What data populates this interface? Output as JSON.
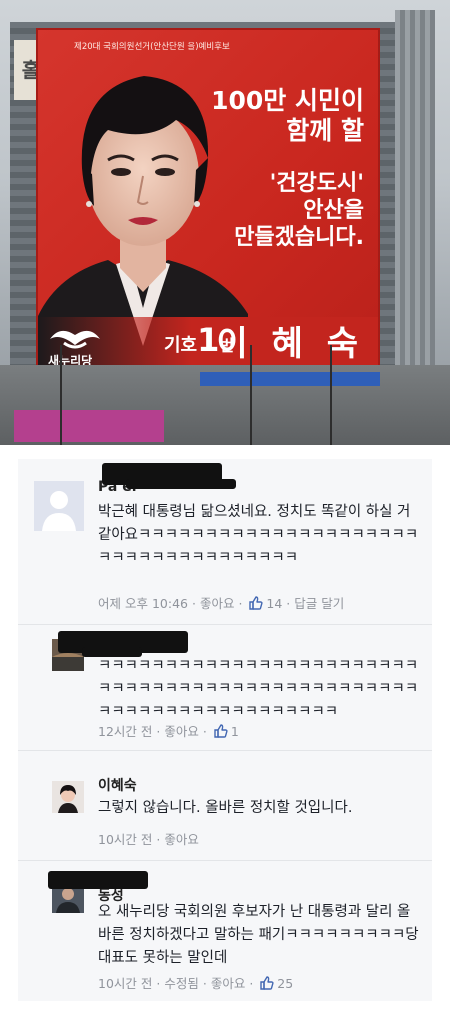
{
  "billboard": {
    "top_caption": "제20대 국회의원선거(안산단원 을)예비후보",
    "left_sign": "홀",
    "slogan": [
      "100만 시민이",
      "함께 할",
      "'건강도시'",
      "안산을",
      "만들겠습니다."
    ],
    "party_name": "새누리당",
    "candidate_label": "기호",
    "candidate_number": "1",
    "candidate_unit": "번",
    "candidate_name": "이 혜 숙",
    "colors": {
      "background": "#c9271f",
      "text": "#ffffff"
    }
  },
  "comments": [
    {
      "author": "Pa               el",
      "text": "박근혜 대통령님 닮으셨네요. 정치도 똑같이 하실 거 같아요ㅋㅋㅋㅋㅋㅋㅋㅋㅋㅋㅋㅋㅋㅋㅋㅋㅋㅋㅋㅋㅋㅋㅋㅋㅋㅋㅋㅋㅋㅋㅋㅋㅋㅋㅋㅋ",
      "time": "어제 오후 10:46",
      "like_label": "좋아요",
      "likes": "14",
      "reply_label": "답글 달기",
      "avatar_icon": "default-profile-icon"
    },
    {
      "author": "",
      "text": "ㅋㅋㅋㅋㅋㅋㅋㅋㅋㅋㅋㅋㅋㅋㅋㅋㅋㅋㅋㅋㅋㅋㅋㅋㅋㅋㅋㅋㅋㅋㅋㅋㅋㅋㅋㅋㅋㅋㅋㅋㅋㅋㅋㅋㅋㅋㅋㅋㅋㅋㅋㅋㅋㅋㅋㅋㅋㅋㅋㅋㅋㅋㅋㅋㅋㅋ",
      "time": "12시간 전",
      "like_label": "좋아요",
      "likes": "1",
      "avatar_icon": "user-photo-icon"
    },
    {
      "author": "이혜숙",
      "text": "그렇지 않습니다. 올바른 정치할 것입니다.",
      "time": "10시간 전",
      "like_label": "좋아요",
      "avatar_icon": "user-photo-icon"
    },
    {
      "author": "         동성",
      "text": "오 새누리당 국회의원 후보자가 난 대통령과 달리 올바른 정치하겠다고 말하는 패기ㅋㅋㅋㅋㅋㅋㅋㅋㅋ당대표도 못하는 말인데",
      "time": "10시간 전",
      "edited_label": "수정됨",
      "like_label": "좋아요",
      "likes": "25",
      "avatar_icon": "user-photo-icon"
    }
  ],
  "separator": "·",
  "colors": {
    "meta": "#90949c",
    "comment_bg": "#f6f7f9",
    "like_blue": "#4267b2"
  }
}
